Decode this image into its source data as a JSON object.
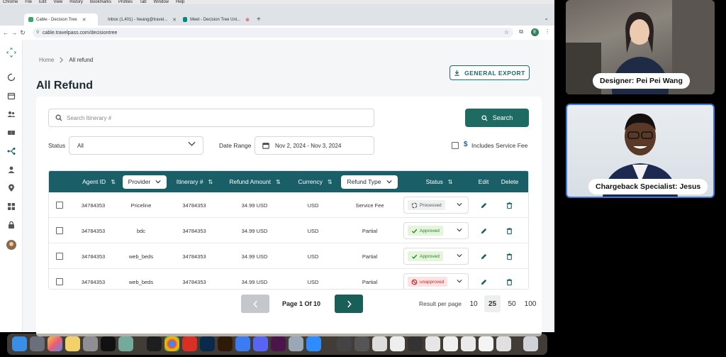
{
  "menubar": {
    "items": [
      "Chrome",
      "File",
      "Edit",
      "View",
      "History",
      "Bookmarks",
      "Profiles",
      "Tab",
      "Window",
      "Help"
    ]
  },
  "browser": {
    "tabs": [
      {
        "title": "Cable - Decision Tree",
        "active": true,
        "favicon_color": "#3aa76d"
      },
      {
        "title": "Inbox (1,401) - hwang@travel...",
        "active": false,
        "favicon_color": "#d44638"
      },
      {
        "title": "Meet - Decision Tree Uni...",
        "active": false,
        "favicon_color": "#00897b"
      }
    ],
    "url": "cable.travelpass.com/decisiontree",
    "profile_initial": "E"
  },
  "breadcrumb": {
    "home": "Home",
    "current": "All refund"
  },
  "page": {
    "title": "All Refund",
    "export_label": "GENERAL EXPORT"
  },
  "search": {
    "placeholder": "Search Itinerary #",
    "button_label": "Search"
  },
  "filters": {
    "status_label": "Status",
    "status_value": "All",
    "date_label": "Date Range",
    "date_value": "Nov 2, 2024 - Nov 3, 2024",
    "fee_symbol": "$",
    "fee_label": "Includes Service Fee"
  },
  "table": {
    "headers": {
      "agent_id": "Agent ID",
      "provider": "Provider",
      "itinerary": "Itinerary #",
      "refund_amount": "Refund Amount",
      "currency": "Currency",
      "refund_type": "Refund Type",
      "status": "Status",
      "edit": "Edit",
      "delete": "Delete"
    },
    "rows": [
      {
        "agent_id": "34784353",
        "provider": "Priceline",
        "itinerary": "34784353",
        "amount": "34.99 USD",
        "currency": "USD",
        "type": "Service Fee",
        "status": "Processed",
        "status_kind": "processed"
      },
      {
        "agent_id": "34784353",
        "provider": "bdc",
        "itinerary": "34784353",
        "amount": "34.99 USD",
        "currency": "USD",
        "type": "Partial",
        "status": "Approved",
        "status_kind": "approved"
      },
      {
        "agent_id": "34784353",
        "provider": "web_beds",
        "itinerary": "34784353",
        "amount": "34.99 USD",
        "currency": "USD",
        "type": "Partial",
        "status": "Approved",
        "status_kind": "approved"
      },
      {
        "agent_id": "34784353",
        "provider": "web_beds",
        "itinerary": "34784353",
        "amount": "34.99 USD",
        "currency": "USD",
        "type": "Partial",
        "status": "unapproved",
        "status_kind": "unapproved"
      }
    ]
  },
  "pagination": {
    "page_label": "Page  1  Of  10",
    "rpp_label": "Result per page",
    "rpp_options": [
      "10",
      "25",
      "50",
      "100"
    ],
    "rpp_selected": "25"
  },
  "participants": [
    {
      "label": "Designer: Pei Pei Wang"
    },
    {
      "label": "Chargeback Specialist: Jesus"
    }
  ],
  "colors": {
    "primary": "#1a5f67",
    "accent_green": "#3aa76d",
    "approved": "#2e7d32",
    "unapproved": "#c62828",
    "active_speaker_border": "#3f7ad8"
  }
}
